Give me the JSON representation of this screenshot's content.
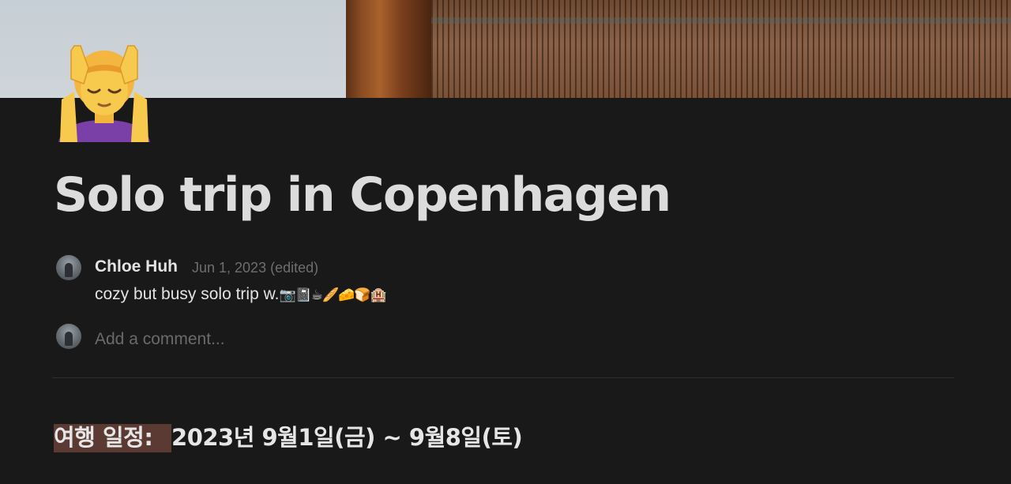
{
  "cover": {
    "description_colors": [
      "#c6cfd5",
      "#8a4c22",
      "#7a5238"
    ]
  },
  "page": {
    "icon": "woman-getting-face-massage-icon",
    "title": "Solo trip in Copenhagen"
  },
  "comment": {
    "author": "Chloe Huh",
    "date": "Jun 1, 2023 (edited)",
    "text": "cozy but busy solo trip w.",
    "emojis": "📷📓☕🥖🧀🍞🏨"
  },
  "comment_input": {
    "placeholder": "Add a comment..."
  },
  "itinerary": {
    "label": "여행 일정: ",
    "value": "2023년 9월1일(금) ~ 9월8일(토)"
  }
}
